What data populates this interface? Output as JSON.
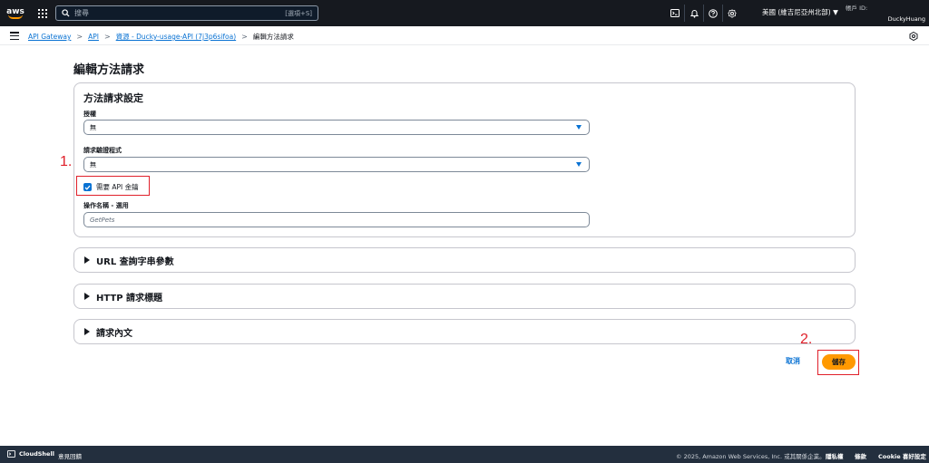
{
  "topnav": {
    "logo_text": "aws",
    "search": {
      "placeholder": "搜尋",
      "shortcut": "[選項+S]"
    },
    "region": "美國 (維吉尼亞州北部) ▼",
    "account": {
      "id_label": "帳戶 ID:",
      "user": "DuckyHuang"
    }
  },
  "breadcrumb": {
    "items": [
      "API Gateway",
      "API",
      "資源 - Ducky-usage-API (7j3p6sifoa)"
    ],
    "current": "編輯方法請求"
  },
  "page": {
    "title": "編輯方法請求",
    "settings_panel": {
      "title": "方法請求設定",
      "authorization": {
        "label": "授權",
        "value": "無"
      },
      "validator": {
        "label": "請求驗證程式",
        "value": "無"
      },
      "api_key": {
        "label": "需要 API 金鑰",
        "checked": true
      },
      "operation_name": {
        "label": "操作名稱 - 選用",
        "placeholder": "GetPets"
      }
    },
    "sections": [
      "URL 查詢字串參數",
      "HTTP 請求標題",
      "請求內文"
    ],
    "actions": {
      "cancel": "取消",
      "save": "儲存"
    }
  },
  "annotations": [
    "1.",
    "2."
  ],
  "footer": {
    "cloudshell": "CloudShell",
    "feedback": "意見回饋",
    "copyright": "© 2025, Amazon Web Services, Inc. 或其關係企業。",
    "privacy": "隱私權",
    "terms": "條款",
    "cookie": "Cookie 喜好設定"
  },
  "colors": {
    "accent": "#0972d3",
    "save": "#ff9900",
    "annotation": "#e0202a",
    "nav": "#16191f"
  }
}
